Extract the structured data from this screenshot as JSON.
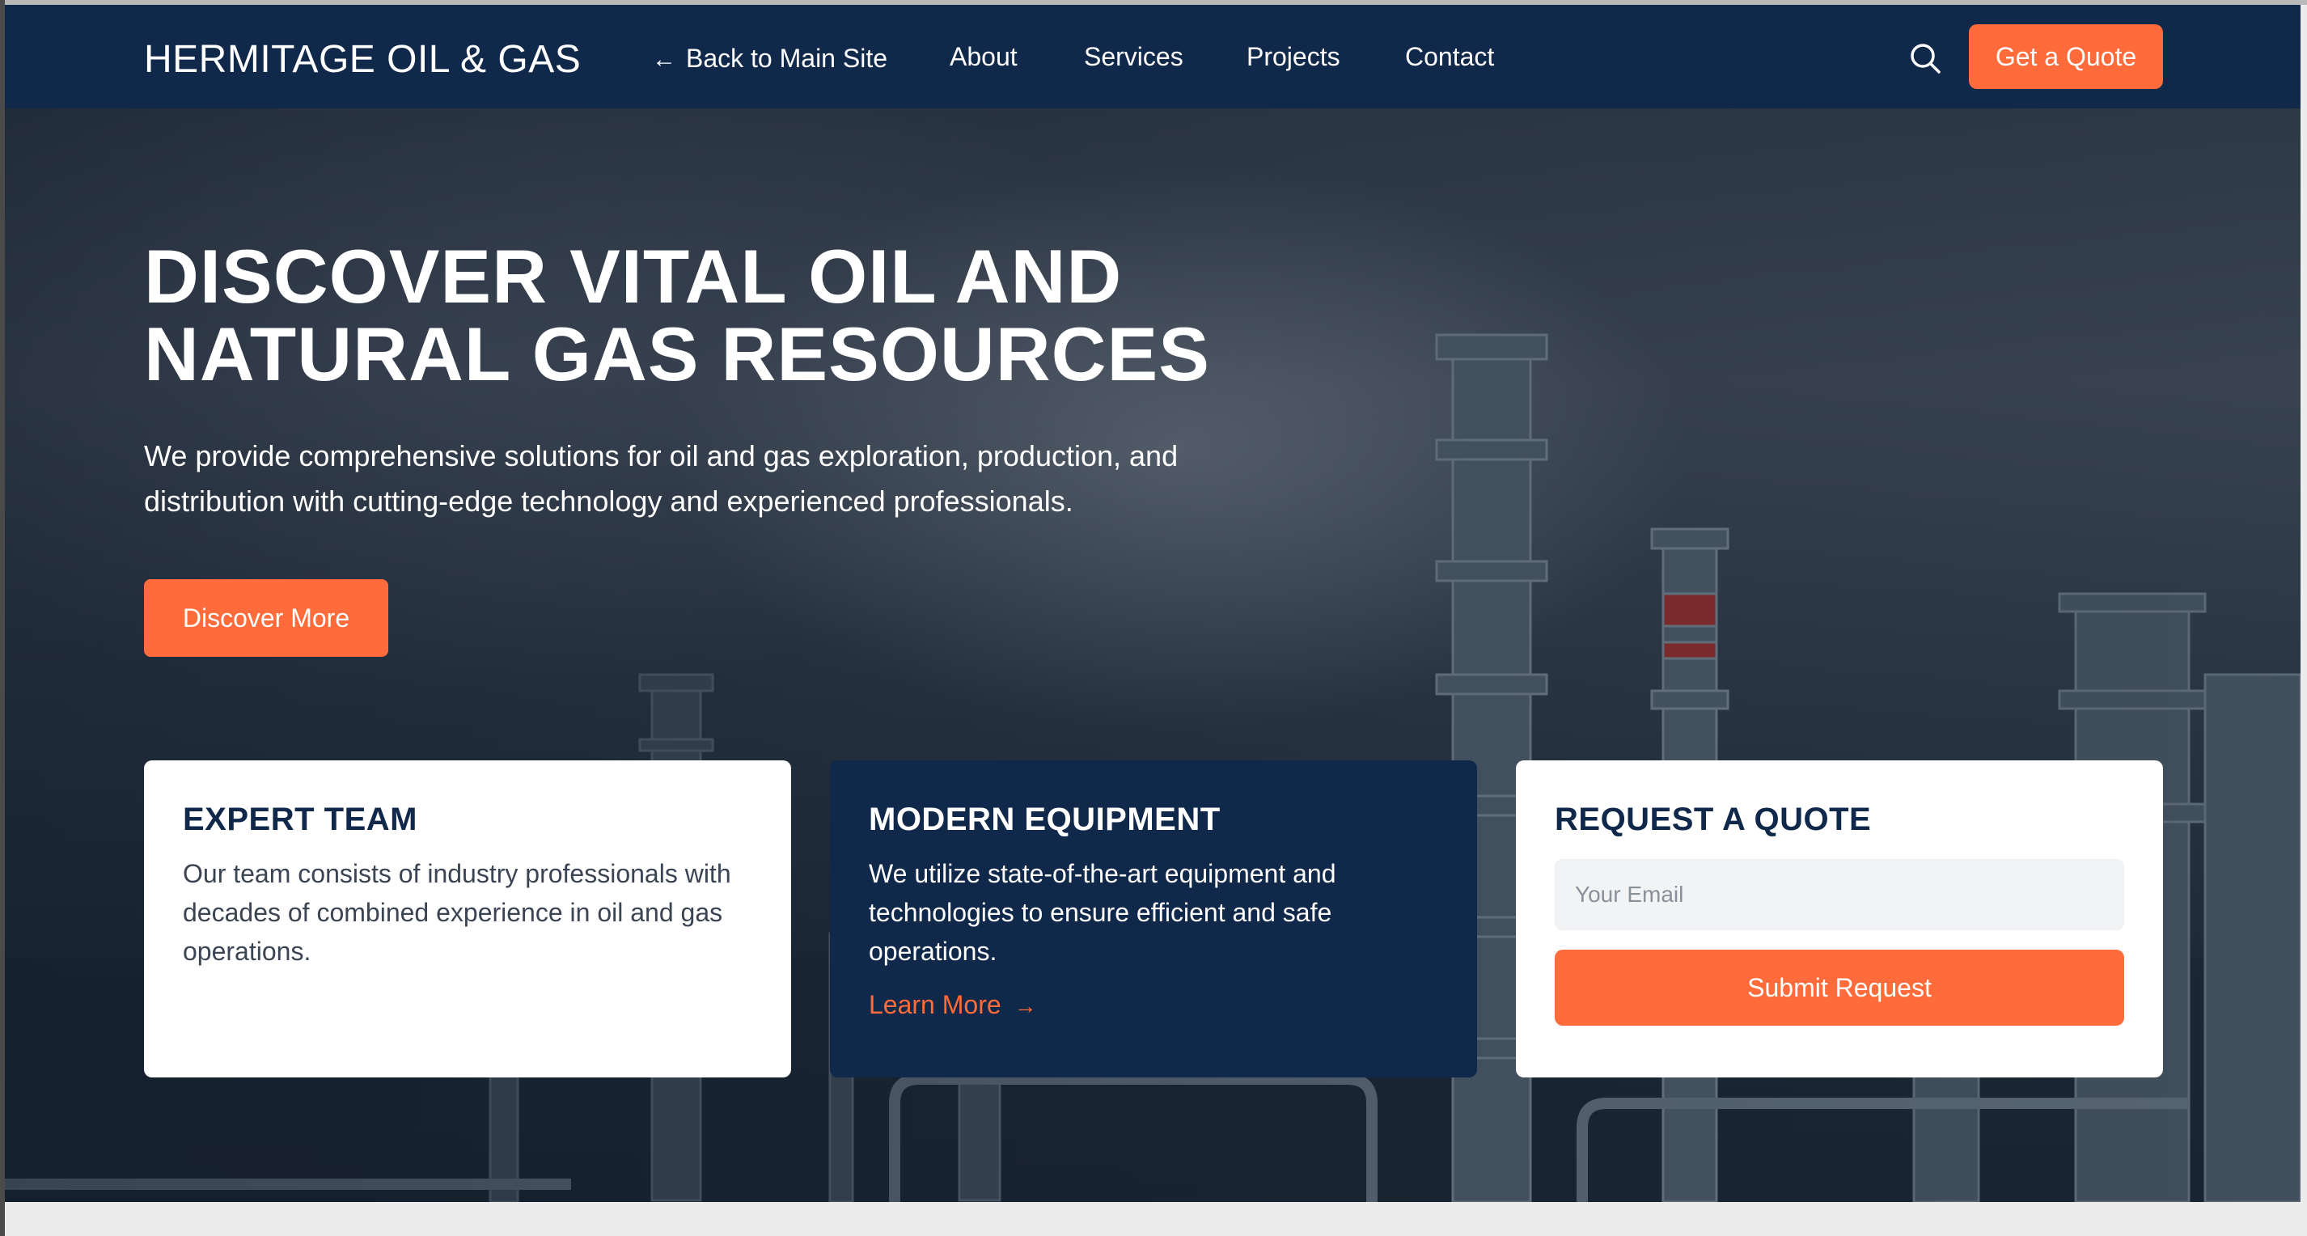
{
  "nav": {
    "brand": "HERMITAGE OIL & GAS",
    "back_label": "Back to Main Site",
    "links": [
      "About",
      "Services",
      "Projects",
      "Contact"
    ],
    "quote_label": "Get a Quote",
    "search_icon": "search-icon",
    "back_icon": "arrow-left-icon"
  },
  "hero": {
    "title_line1": "DISCOVER VITAL OIL AND",
    "title_line2": "NATURAL GAS RESOURCES",
    "subtitle": "We provide comprehensive solutions for oil and gas exploration, production, and distribution with cutting-edge technology and experienced professionals.",
    "cta_label": "Discover More"
  },
  "cards": {
    "expert": {
      "title": "EXPERT TEAM",
      "body": "Our team consists of industry professionals with decades of combined experience in oil and gas operations."
    },
    "equipment": {
      "title": "MODERN EQUIPMENT",
      "body": "We utilize state-of-the-art equipment and technologies to ensure efficient and safe operations.",
      "link_label": "Learn More",
      "link_icon": "arrow-right-icon"
    },
    "quote": {
      "title": "REQUEST A QUOTE",
      "email_placeholder": "Your Email",
      "submit_label": "Submit Request"
    }
  },
  "colors": {
    "navy": "#10284a",
    "accent": "#ff6b3a",
    "white": "#ffffff"
  }
}
